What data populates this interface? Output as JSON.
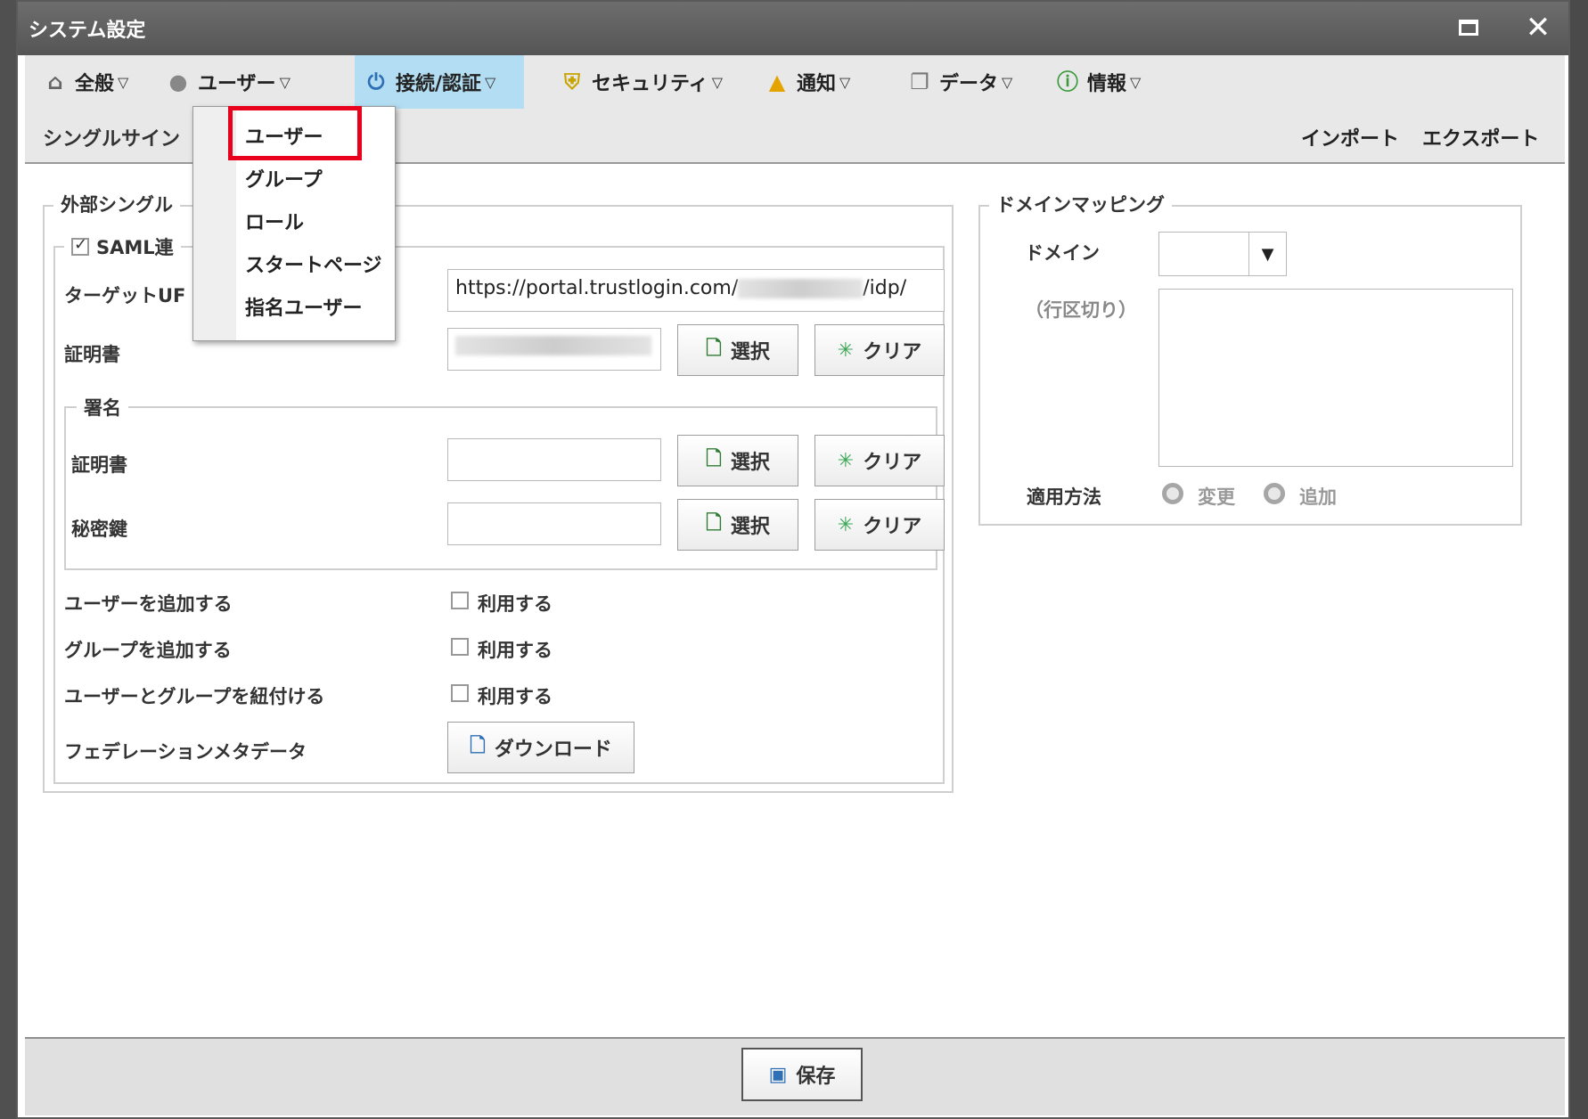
{
  "window": {
    "title": "システム設定"
  },
  "menubar": {
    "items": [
      {
        "label": "全般",
        "icon": "home-icon"
      },
      {
        "label": "ユーザー",
        "icon": "user-icon"
      },
      {
        "label": "接続/認証",
        "icon": "plug-icon"
      },
      {
        "label": "セキュリティ",
        "icon": "shield-icon"
      },
      {
        "label": "通知",
        "icon": "bell-icon"
      },
      {
        "label": "データ",
        "icon": "copy-icon"
      },
      {
        "label": "情報",
        "icon": "info-icon"
      }
    ],
    "caret": "▽",
    "sub_tab": "シングルサイン",
    "import": "インポート",
    "export": "エクスポート"
  },
  "dropdown": {
    "items": [
      "ユーザー",
      "グループ",
      "ロール",
      "スタートページ",
      "指名ユーザー"
    ],
    "highlighted_color": "#e8001c"
  },
  "sso": {
    "legend": "外部シングル",
    "saml_label": "SAML連",
    "saml_checked": true,
    "target_url_label": "ターゲットUF",
    "target_url_value_start": "https://portal.trustlogin.com/",
    "target_url_value_end": "/idp/",
    "cert_label": "証明書",
    "select_label": "選択",
    "clear_label": "クリア",
    "signing": {
      "legend": "署名",
      "cert_label": "証明書",
      "key_label": "秘密鍵"
    },
    "add_user_label": "ユーザーを追加する",
    "add_group_label": "グループを追加する",
    "link_label": "ユーザーとグループを紐付ける",
    "use_label": "利用する",
    "metadata_label": "フェデレーションメタデータ",
    "download_label": "ダウンロード"
  },
  "domain_mapping": {
    "legend": "ドメインマッピング",
    "domain_label": "ドメイン",
    "domain_value": "",
    "line_break_note": "（行区切り）",
    "apply_label": "適用方法",
    "option_change": "変更",
    "option_add": "追加"
  },
  "footer": {
    "save_label": "保存"
  }
}
